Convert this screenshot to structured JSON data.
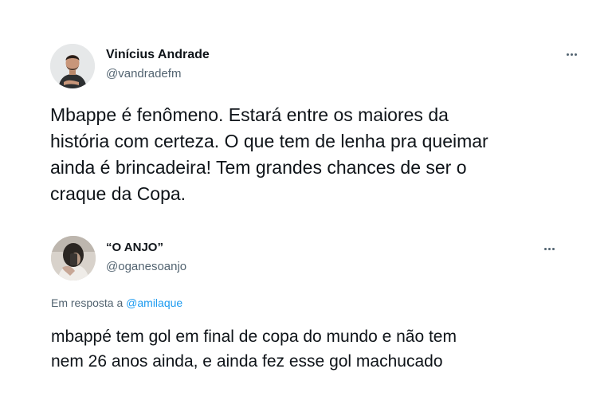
{
  "tweet1": {
    "display_name": "Vinícius Andrade",
    "handle": "@vandradefm",
    "text": "Mbappe é fenômeno. Estará entre os maiores da\nhistória com certeza. O que tem de lenha pra queimar\nainda é brincadeira! Tem grandes chances de ser o\ncraque da Copa.",
    "avatar_icon": "profile-photo",
    "more_icon": "more-horizontal-icon"
  },
  "tweet2": {
    "display_name": "“O ANJO”",
    "handle": "@oganesoanjo",
    "reply_prefix": "Em resposta a ",
    "reply_mention": "@amilaque",
    "text": "mbappé tem gol em final de copa do mundo e não tem\nnem 26 anos ainda, e ainda fez esse gol machucado",
    "avatar_icon": "profile-photo",
    "more_icon": "more-horizontal-icon"
  },
  "colors": {
    "primary_text": "#0f1419",
    "secondary_text": "#536471",
    "link": "#1d9bf0"
  }
}
